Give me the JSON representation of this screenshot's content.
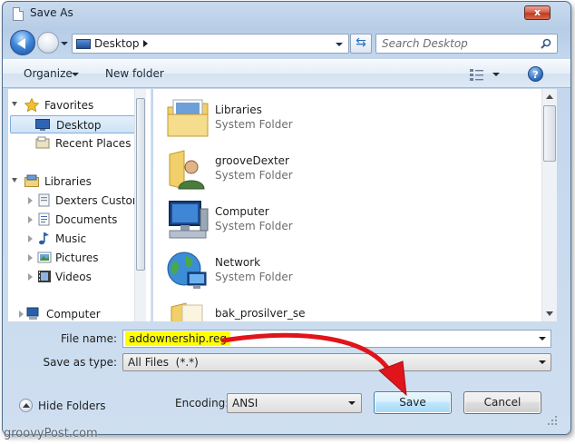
{
  "window": {
    "title": "Save As",
    "close_label": "x"
  },
  "address": {
    "location": "Desktop"
  },
  "search": {
    "placeholder": "Search Desktop"
  },
  "toolbar": {
    "organize_label": "Organize",
    "new_folder_label": "New folder",
    "help_label": "?"
  },
  "sidebar": {
    "items": [
      {
        "label": "Favorites",
        "icon": "star-icon"
      },
      {
        "label": "Desktop",
        "icon": "desktop-icon",
        "selected": true
      },
      {
        "label": "Recent Places",
        "icon": "recent-places-icon"
      },
      {
        "label": "Libraries",
        "icon": "libraries-icon"
      },
      {
        "label": "Dexters Custom",
        "icon": "library-icon"
      },
      {
        "label": "Documents",
        "icon": "documents-icon"
      },
      {
        "label": "Music",
        "icon": "music-icon"
      },
      {
        "label": "Pictures",
        "icon": "pictures-icon"
      },
      {
        "label": "Videos",
        "icon": "videos-icon"
      },
      {
        "label": "Computer",
        "icon": "computer-icon"
      }
    ]
  },
  "files": [
    {
      "name": "Libraries",
      "type": "System Folder",
      "icon": "libraries-folder-icon"
    },
    {
      "name": "grooveDexter",
      "type": "System Folder",
      "icon": "user-folder-icon"
    },
    {
      "name": "Computer",
      "type": "System Folder",
      "icon": "computer-icon"
    },
    {
      "name": "Network",
      "type": "System Folder",
      "icon": "network-icon"
    },
    {
      "name": "bak_prosilver_se",
      "type": "",
      "icon": "folder-icon"
    }
  ],
  "form": {
    "file_name_label": "File name:",
    "file_name_value": "addownership.reg",
    "save_type_label": "Save as type:",
    "save_type_value": "All Files  (*.*)"
  },
  "footer": {
    "hide_folders_label": "Hide Folders",
    "encoding_label": "Encoding:",
    "encoding_value": "ANSI",
    "save_label": "Save",
    "cancel_label": "Cancel"
  },
  "watermark": "groovyPost.com",
  "colors": {
    "highlight": "#ffff00",
    "annotation_arrow": "#e0141b",
    "selection": "#cde3f7"
  }
}
